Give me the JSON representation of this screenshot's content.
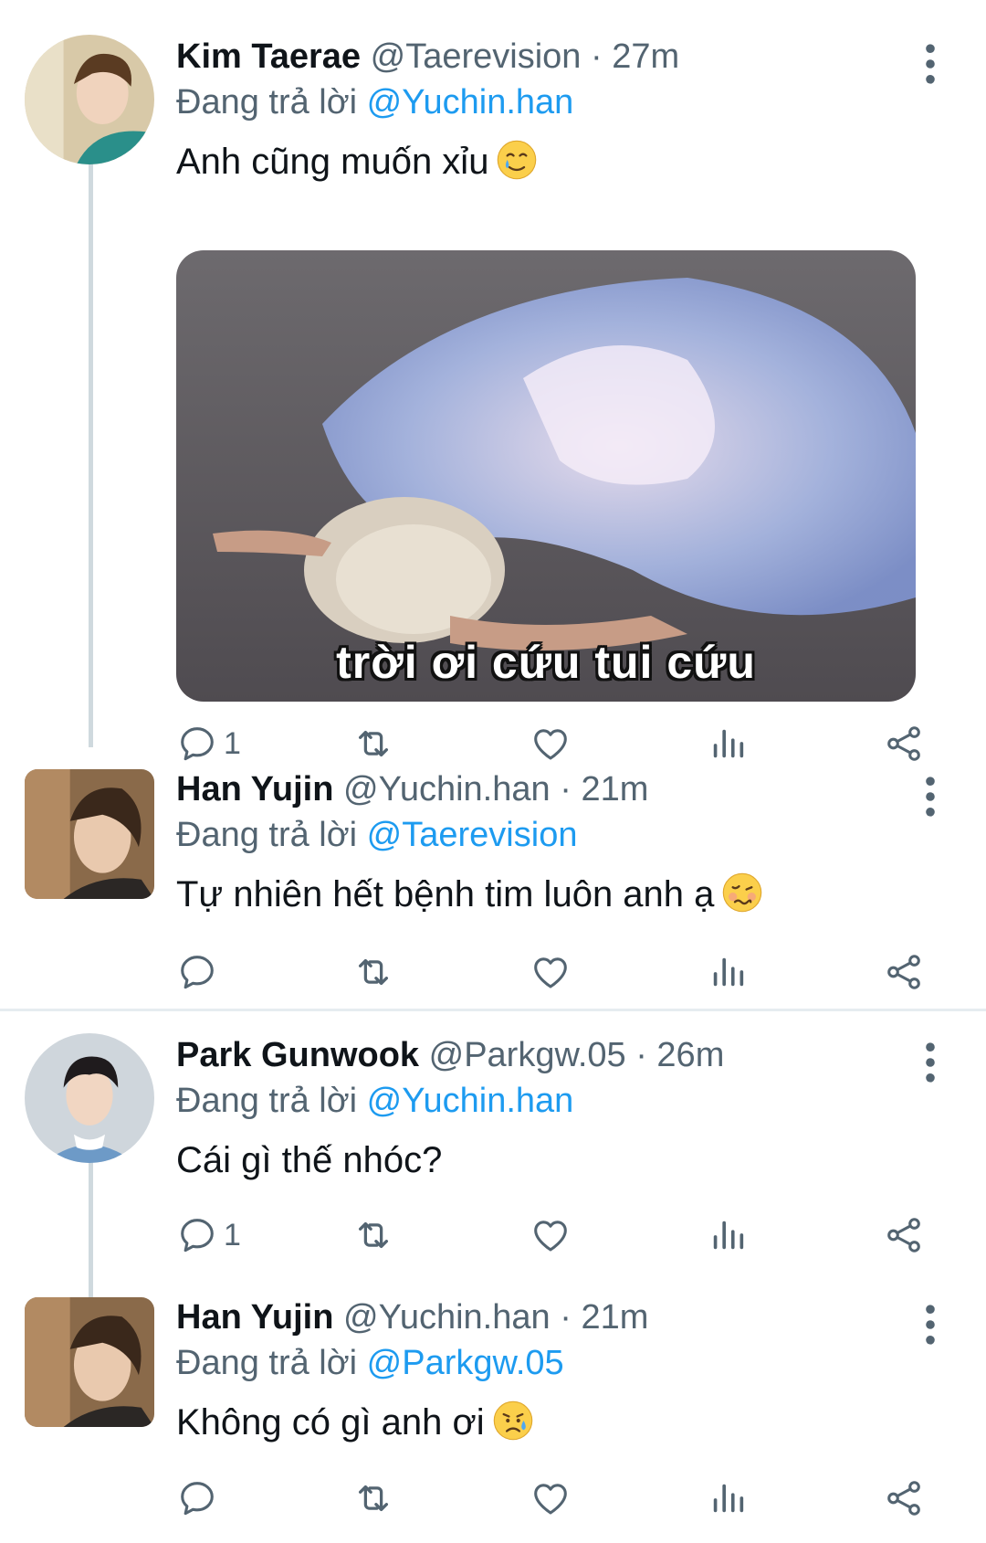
{
  "tweets": [
    {
      "name": "Kim Taerae",
      "handle": "@Taerevision",
      "time": "27m",
      "reply_prefix": "Đang trả lời",
      "reply_to": "@Yuchin.han",
      "text": "Anh cũng muốn xỉu",
      "emoji": "smiling-face-with-tear",
      "media_caption": "trời ơi cứu tui cứu",
      "reply_count": "1"
    },
    {
      "name": "Han Yujin",
      "handle": "@Yuchin.han",
      "time": "21m",
      "reply_prefix": "Đang trả lời",
      "reply_to": "@Taerevision",
      "text": "Tự nhiên hết bệnh tim luôn anh ạ",
      "emoji": "woozy-face",
      "reply_count": ""
    },
    {
      "name": "Park Gunwook",
      "handle": "@Parkgw.05",
      "time": "26m",
      "reply_prefix": "Đang trả lời",
      "reply_to": "@Yuchin.han",
      "text": "Cái gì thế nhóc?",
      "reply_count": "1"
    },
    {
      "name": "Han Yujin",
      "handle": "@Yuchin.han",
      "time": "21m",
      "reply_prefix": "Đang trả lời",
      "reply_to": "@Parkgw.05",
      "text": "Không có gì anh ơi",
      "emoji": "sad-but-relieved-face",
      "reply_count": ""
    }
  ],
  "separator": "·",
  "colors": {
    "accent": "#1d9bf0",
    "muted": "#536471",
    "text": "#0f1419",
    "thread_line": "#cfd9de"
  }
}
